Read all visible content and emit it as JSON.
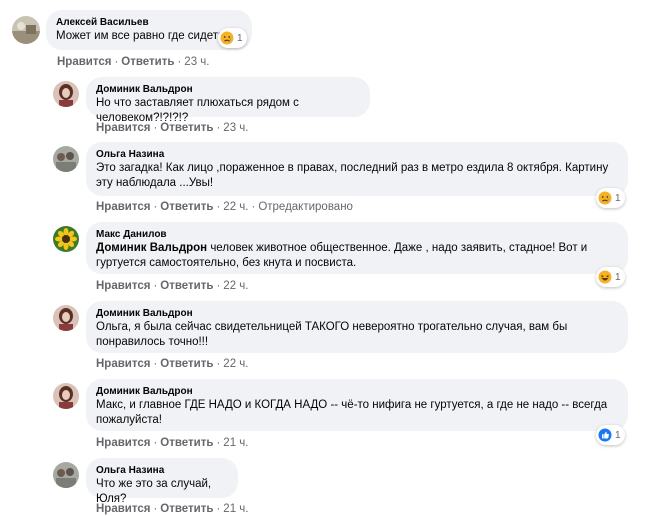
{
  "actions": {
    "like": "Нравится",
    "reply": "Ответить",
    "dot": "·"
  },
  "comments": [
    {
      "author": "Алексей Васильев",
      "text": "Может им все равно где сидеть.",
      "time": "23 ч.",
      "reaction": {
        "icon": "sad-emoji-icon",
        "count": "1"
      }
    },
    {
      "author": "Доминик Вальдрон",
      "text": "Но что заставляет плюхаться рядом с человеком?!?!?!?",
      "time": "23 ч."
    },
    {
      "author": "Ольга Назина",
      "text": "Это загадка! Как лицо ,пораженное в правах, последний раз в метро ездила 8 октября. Картину эту наблюдала ...Увы!",
      "time": "22 ч.",
      "edited": "Отредактировано",
      "reaction": {
        "icon": "sad-emoji-icon",
        "count": "1"
      }
    },
    {
      "author": "Макс Данилов",
      "mention": "Доминик Вальдрон",
      "text": " человек животное общественное. Даже , надо заявить, стадное! Вот и гуртуется самостоятельно, без кнута и посвиста.",
      "time": "22 ч.",
      "reaction": {
        "icon": "laughing-emoji-icon",
        "count": "1"
      }
    },
    {
      "author": "Доминик Вальдрон",
      "text": "Ольга, я была сейчас свидетельницей ТАКОГО невероятно трогательно случая, вам бы понравилось точно!!!",
      "time": "22 ч."
    },
    {
      "author": "Доминик Вальдрон",
      "text": "Макс, и главное ГДЕ НАДО и КОГДА НАДО -- чё-то нифига не гуртуется, а где не надо -- всегда пожалуйста!",
      "time": "21 ч.",
      "reaction": {
        "icon": "like-icon",
        "count": "1"
      }
    },
    {
      "author": "Ольга Назина",
      "text": "Что же это за случай, Юля?",
      "time": "21 ч."
    }
  ],
  "colors": {
    "bubble": "#f0f2f5",
    "secondary_text": "#65676b",
    "like_blue": "#1877f2",
    "emoji_yellow": "#f7b125"
  }
}
